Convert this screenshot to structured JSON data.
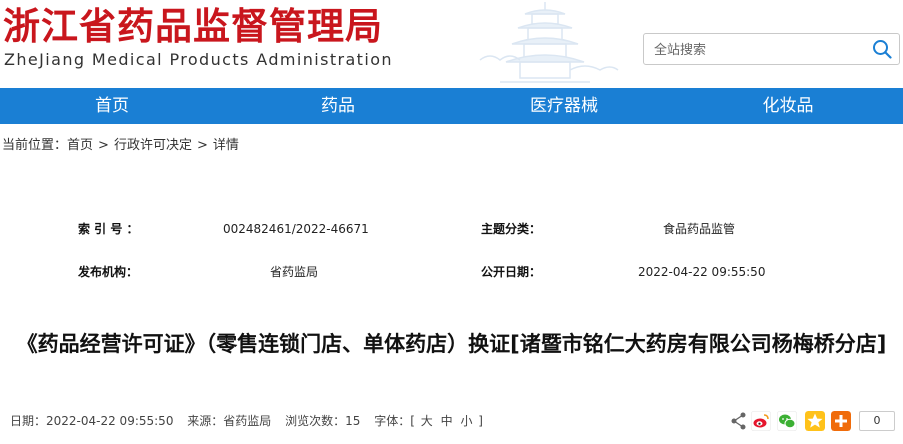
{
  "header": {
    "title": "浙江省药品监督管理局",
    "subtitle": "ZheJiang Medical Products Administration"
  },
  "search": {
    "placeholder": "全站搜索"
  },
  "nav": {
    "items": [
      {
        "label": "首页"
      },
      {
        "label": "药品"
      },
      {
        "label": "医疗器械"
      },
      {
        "label": "化妆品"
      }
    ]
  },
  "breadcrumb": {
    "prefix": "当前位置：",
    "items": [
      "首页",
      "行政许可决定",
      "详情"
    ],
    "separator": ">"
  },
  "meta": {
    "index_label": "索 引 号 ：",
    "index_value": "002482461/2022-46671",
    "topic_label": "主题分类：",
    "topic_value": "食品药品监管",
    "issuer_label": "发布机构：",
    "issuer_value": "省药监局",
    "date_label": "公开日期：",
    "date_value": "2022-04-22 09:55:50"
  },
  "article": {
    "title": "《药品经营许可证》（零售连锁门店、单体药店）换证[诸暨市铭仁大药房有限公司杨梅桥分店]"
  },
  "info": {
    "date": "日期：2022-04-22 09:55:50",
    "source": "来源：省药监局",
    "views": "浏览次数：15",
    "font_label": "字体：[",
    "font_large": "大",
    "font_medium": "中",
    "font_small": "小",
    "font_end": "]"
  },
  "share": {
    "count": "0"
  },
  "colors": {
    "brand_red": "#c9161d",
    "nav_blue": "#1a7fd4"
  }
}
